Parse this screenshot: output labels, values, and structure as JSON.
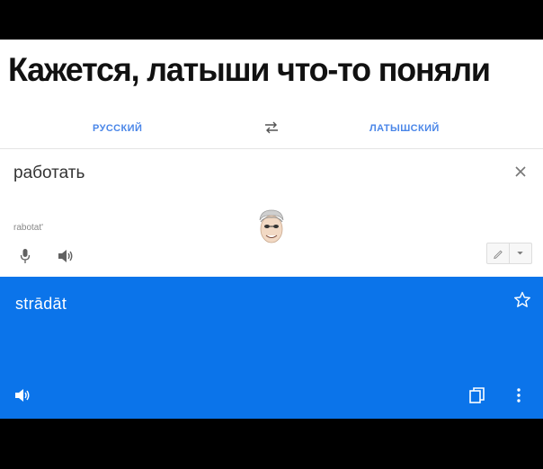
{
  "caption": "Кажется, латыши что-то поняли",
  "languages": {
    "source": "РУССКИЙ",
    "target": "ЛАТЫШСКИЙ"
  },
  "source": {
    "text": "работать",
    "transliteration": "rabotat'"
  },
  "translation": {
    "text": "strādāt"
  },
  "colors": {
    "accent": "#4a86e8",
    "translation_bg": "#0b74ea",
    "background": "#ffffff"
  }
}
